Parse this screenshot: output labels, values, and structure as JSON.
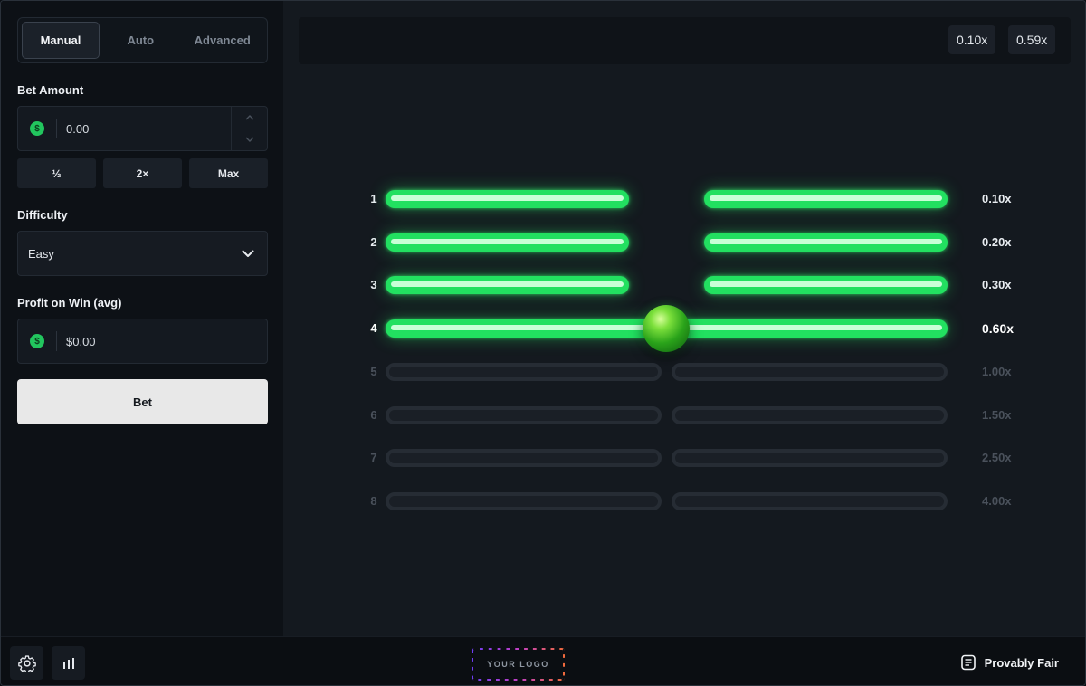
{
  "tabs": [
    "Manual",
    "Auto",
    "Advanced"
  ],
  "bet": {
    "label": "Bet Amount",
    "value": "0.00",
    "currency_symbol": "$",
    "quick": [
      "½",
      "2×",
      "Max"
    ]
  },
  "difficulty": {
    "label": "Difficulty",
    "value": "Easy"
  },
  "profit": {
    "label": "Profit on Win (avg)",
    "value": "$0.00",
    "currency_symbol": "$"
  },
  "bet_button": "Bet",
  "history": [
    "0.10x",
    "0.59x"
  ],
  "rows": [
    {
      "num": "1",
      "mult": "0.10x",
      "state": "passed"
    },
    {
      "num": "2",
      "mult": "0.20x",
      "state": "passed"
    },
    {
      "num": "3",
      "mult": "0.30x",
      "state": "passed"
    },
    {
      "num": "4",
      "mult": "0.60x",
      "state": "current"
    },
    {
      "num": "5",
      "mult": "1.00x",
      "state": "locked"
    },
    {
      "num": "6",
      "mult": "1.50x",
      "state": "locked"
    },
    {
      "num": "7",
      "mult": "2.50x",
      "state": "locked"
    },
    {
      "num": "8",
      "mult": "4.00x",
      "state": "locked"
    }
  ],
  "footer": {
    "logo": "YOUR LOGO",
    "provably_fair": "Provably Fair"
  },
  "colors": {
    "accent_green": "#22e060",
    "bet_button_bg": "#e8e8e8"
  },
  "icons": {
    "settings": "gear-icon",
    "stats": "bar-chart-icon",
    "fair": "receipt-icon",
    "select_caret": "chevron-down-icon"
  }
}
